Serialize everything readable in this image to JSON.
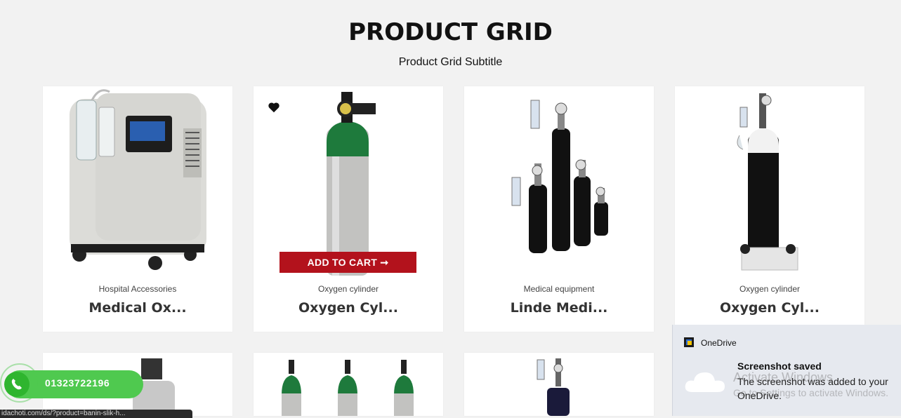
{
  "header": {
    "title": "PRODUCT GRID",
    "subtitle": "Product Grid Subtitle"
  },
  "products": [
    {
      "category": "Hospital Accessories",
      "name": "Medical Ox...",
      "image": "oxygen-concentrator"
    },
    {
      "category": "Oxygen cylinder",
      "name": "Oxygen Cyl...",
      "image": "aluminum-oxygen-cylinder",
      "add_to_cart": "ADD TO CART",
      "wishlist": "heart-icon"
    },
    {
      "category": "Medical equipment",
      "name": "Linde Medi...",
      "image": "cylinder-set"
    },
    {
      "category": "Oxygen cylinder",
      "name": "Oxygen Cyl...",
      "image": "cylinder-trolley"
    }
  ],
  "call_button": {
    "number": "01323722196",
    "icon": "phone-icon",
    "color": "#4fc94f"
  },
  "status_bar": {
    "text": "idachoti.com/ds/?product=banin-slik-h..."
  },
  "toast": {
    "app": "OneDrive",
    "title": "Screenshot saved",
    "message": "The screenshot was added to your OneDrive."
  },
  "watermark": {
    "line1": "Activate Windows",
    "line2": "Go to Settings to activate Windows."
  },
  "colors": {
    "accent_red": "#b3121c",
    "background": "#f2f2f2"
  }
}
